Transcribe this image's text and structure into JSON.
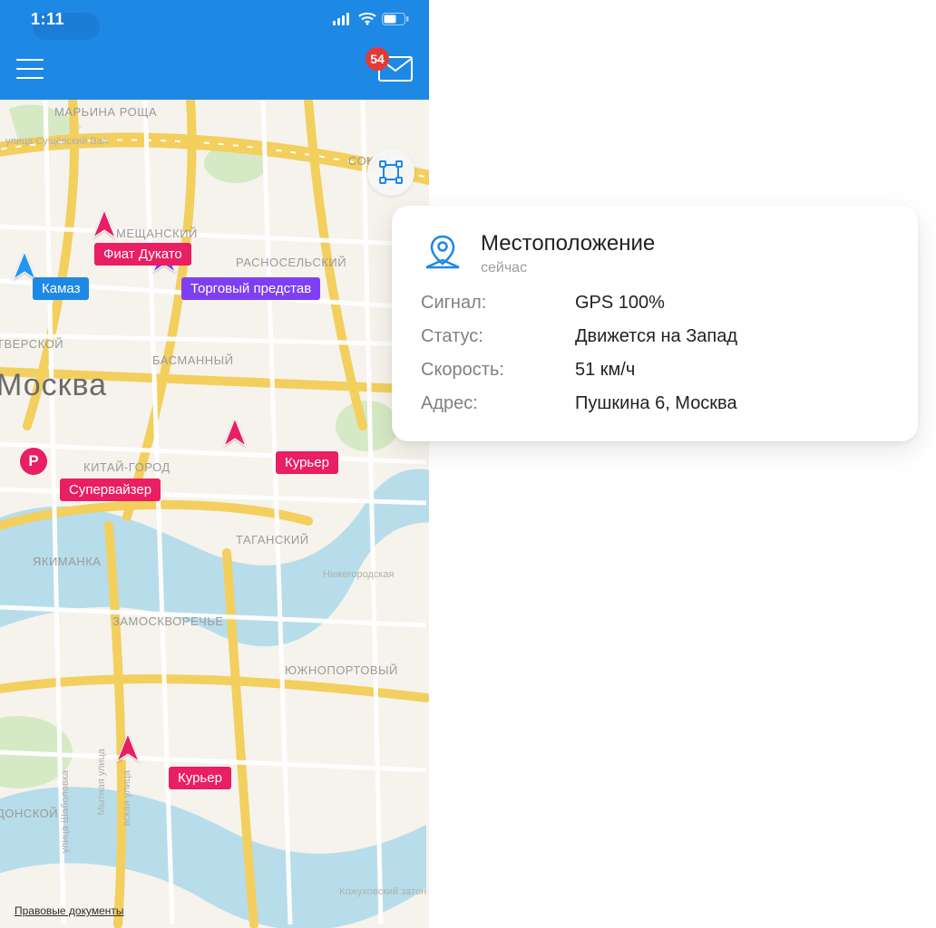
{
  "status": {
    "time": "1:11"
  },
  "nav": {
    "badge": "54"
  },
  "map": {
    "city": "Москва",
    "districts": {
      "maryina": "МАРЬИНА РОЩА",
      "sokol": "СОКОЛ",
      "meshchansky": "МЕЩАНСКИЙ",
      "krasnoselsky": "РАСНОСЕЛЬСКИЙ",
      "tverskoy": "ТВЕРСКОЙ",
      "basmanny": "БАСМАННЫЙ",
      "kitay": "КИТАЙ-ГОРОД",
      "yakimanka": "ЯКИМАНКА",
      "tagansky": "ТАГАНСКИЙ",
      "zamoskvorechye": "ЗАМОСКВОРЕЧЬЕ",
      "yuzhnoport": "ЮЖНОПОРТОВЫЙ",
      "donskoy": "ДОНСКОЙ"
    },
    "streets": {
      "sushchevsky": "улица Сущёвский Вал",
      "nizhegorod": "Нижегородская",
      "shabolovka": "улица Шаболовка",
      "mytnaya": "Мытная улица",
      "lyusinovskaya": "вская улица",
      "kozhukhov": "Кожуховский затон"
    },
    "tags": {
      "fiat": "Фиат Дукато",
      "kamaz": "Камаз",
      "sales": "Торговый представ",
      "supervisor": "Супервайзер",
      "courier1": "Курьер",
      "courier2": "Курьер"
    },
    "parking": "P",
    "legal": "Правовые документы"
  },
  "card": {
    "title": "Местоположение",
    "subtitle": "сейчас",
    "rows": {
      "signal_k": "Сигнал:",
      "signal_v": "GPS 100%",
      "status_k": "Статус:",
      "status_v": "Движется на Запад",
      "speed_k": "Скорость:",
      "speed_v": "51 км/ч",
      "address_k": "Адрес:",
      "address_v": "Пушкина 6, Москва"
    }
  }
}
